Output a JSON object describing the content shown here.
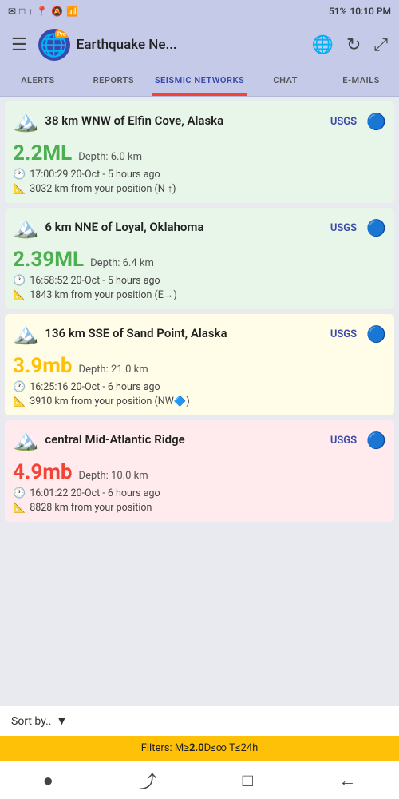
{
  "statusBar": {
    "leftIcons": [
      "✉",
      "□",
      "↑"
    ],
    "signal": "📍",
    "battery": "51%",
    "time": "10:10 PM"
  },
  "appBar": {
    "title": "Earthquake Ne...",
    "pro_badge": "Pro"
  },
  "tabs": [
    {
      "id": "alerts",
      "label": "ALERTS",
      "active": false
    },
    {
      "id": "reports",
      "label": "REPORTS",
      "active": false
    },
    {
      "id": "seismic",
      "label": "SEISMIC NETWORKS",
      "active": true
    },
    {
      "id": "chat",
      "label": "CHAT",
      "active": false
    },
    {
      "id": "emails",
      "label": "E-MAILS",
      "active": false
    }
  ],
  "earthquakes": [
    {
      "id": "eq1",
      "cardColor": "card-green",
      "location": "38 km WNW of Elfin Cove, Alaska",
      "source": "USGS",
      "magnitude": "2.2",
      "magnitudeUnit": "ML",
      "magnitudeColor": "green",
      "depth": "Depth: 6.0 km",
      "time": "17:00:29 20-Oct - 5 hours ago",
      "distance": "3032 km from your position (N ↑)"
    },
    {
      "id": "eq2",
      "cardColor": "card-green",
      "location": "6 km NNE of Loyal, Oklahoma",
      "source": "USGS",
      "magnitude": "2.39",
      "magnitudeUnit": "ML",
      "magnitudeColor": "green",
      "depth": "Depth: 6.4 km",
      "time": "16:58:52 20-Oct - 5 hours ago",
      "distance": "1843 km from your position (E→)"
    },
    {
      "id": "eq3",
      "cardColor": "card-yellow",
      "location": "136 km SSE of Sand Point, Alaska",
      "source": "USGS",
      "magnitude": "3.9",
      "magnitudeUnit": "mb",
      "magnitudeColor": "yellow",
      "depth": "Depth: 21.0 km",
      "time": "16:25:16 20-Oct - 6 hours ago",
      "distance": "3910 km from your position (NW🔷)"
    },
    {
      "id": "eq4",
      "cardColor": "card-red",
      "location": "central Mid-Atlantic Ridge",
      "source": "USGS",
      "magnitude": "4.9",
      "magnitudeUnit": "mb",
      "magnitudeColor": "red",
      "depth": "Depth: 10.0 km",
      "time": "16:01:22 20-Oct - 6 hours ago",
      "distance": "8828 km from your position"
    }
  ],
  "bottomBar": {
    "sortLabel": "Sort by..",
    "filterText": "Filters: M≥",
    "filterMag": "2.0",
    "filterRest": "D≤∞ T≤24h"
  },
  "navBar": {
    "icons": [
      "●",
      "⤴",
      "□",
      "←"
    ]
  }
}
